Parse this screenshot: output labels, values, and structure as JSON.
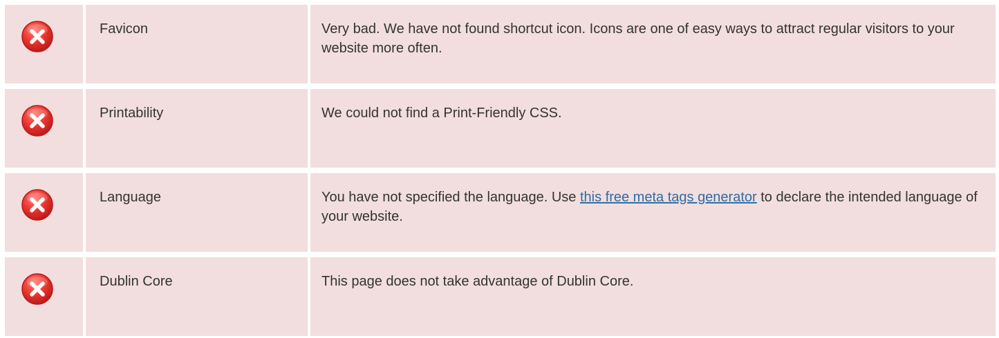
{
  "colors": {
    "row_background": "#f2dede",
    "text": "#333333",
    "link": "#2e6da4",
    "error_icon": "#e8322c"
  },
  "rows": [
    {
      "icon": "error-x-icon",
      "name": "Favicon",
      "description": "Very bad. We have not found shortcut icon. Icons are one of easy ways to attract regular visitors to your website more often."
    },
    {
      "icon": "error-x-icon",
      "name": "Printability",
      "description": "We could not find a Print-Friendly CSS."
    },
    {
      "icon": "error-x-icon",
      "name": "Language",
      "description_before": "You have not specified the language. Use ",
      "link_text": "this free meta tags generator",
      "description_after": " to declare the intended language of your website."
    },
    {
      "icon": "error-x-icon",
      "name": "Dublin Core",
      "description": "This page does not take advantage of Dublin Core."
    }
  ]
}
